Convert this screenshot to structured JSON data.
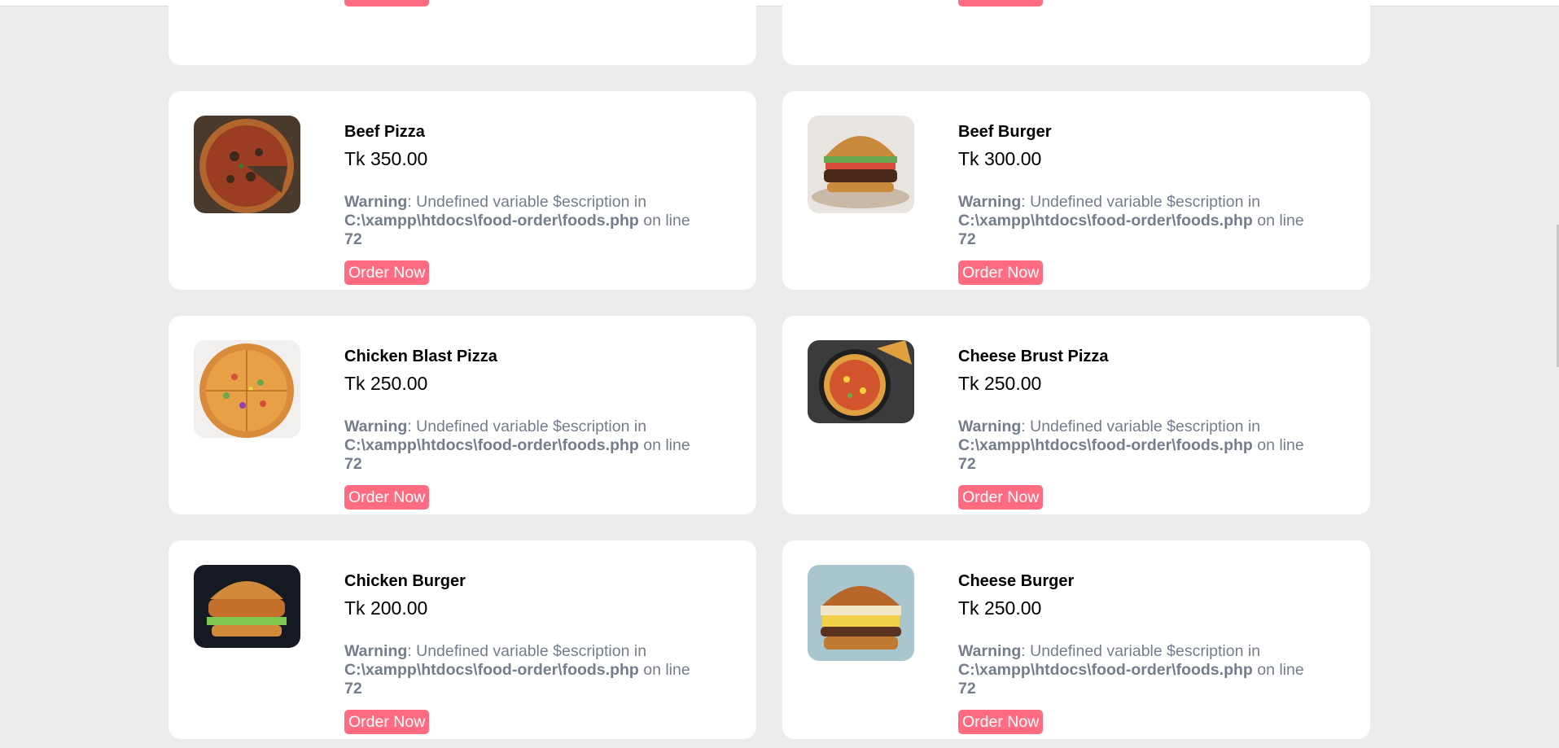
{
  "warning": {
    "label": "Warning",
    "message": ": Undefined variable $escription in ",
    "path": "C:\\xampp\\htdocs\\food-order\\foods.php",
    "online": " on line ",
    "line": "72"
  },
  "order_label": "Order Now",
  "foods": [
    {
      "name": "",
      "price": "",
      "image": "food-image"
    },
    {
      "name": "",
      "price": "",
      "image": "food-image"
    },
    {
      "name": "Beef Pizza",
      "price": "Tk 350.00",
      "image": "pizza-image"
    },
    {
      "name": "Beef Burger",
      "price": "Tk 300.00",
      "image": "burger-image"
    },
    {
      "name": "Chicken Blast Pizza",
      "price": "Tk 250.00",
      "image": "pizza-image"
    },
    {
      "name": "Cheese Brust Pizza",
      "price": "Tk 250.00",
      "image": "pizza-image"
    },
    {
      "name": "Chicken Burger",
      "price": "Tk 200.00",
      "image": "burger-image"
    },
    {
      "name": "Cheese Burger",
      "price": "Tk 250.00",
      "image": "burger-image"
    }
  ],
  "colors": {
    "background": "#ececec",
    "card": "#ffffff",
    "button": "#ff6b81",
    "warning_text": "#747d8c"
  }
}
